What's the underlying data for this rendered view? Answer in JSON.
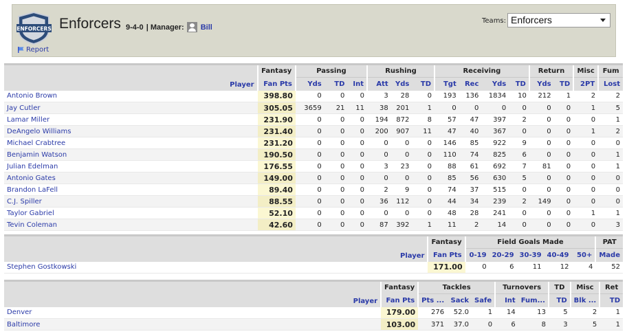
{
  "header": {
    "team_name": "Enforcers",
    "record": "9-4-0",
    "manager_label": "| Manager:",
    "manager_name": "Bill",
    "report_label": "Report",
    "logo_text": "ENFORCERS",
    "teams_label": "Teams:",
    "teams_selected": "Enforcers"
  },
  "offense": {
    "group_headers": [
      "Fantasy",
      "Passing",
      "Rushing",
      "Receiving",
      "Return",
      "Misc",
      "Fum"
    ],
    "player_header": "Player",
    "fan_pts_header": "Fan Pts",
    "sub_headers": [
      "Yds",
      "TD",
      "Int",
      "Att",
      "Yds",
      "TD",
      "Tgt",
      "Rec",
      "Yds",
      "TD",
      "Yds",
      "TD",
      "2PT",
      "Lost"
    ],
    "rows": [
      {
        "name": "Antonio Brown",
        "pts": "398.80",
        "stats": [
          "0",
          "0",
          "0",
          "3",
          "28",
          "0",
          "193",
          "136",
          "1834",
          "10",
          "212",
          "1",
          "2",
          "2"
        ]
      },
      {
        "name": "Jay Cutler",
        "pts": "305.05",
        "stats": [
          "3659",
          "21",
          "11",
          "38",
          "201",
          "1",
          "0",
          "0",
          "0",
          "0",
          "0",
          "0",
          "1",
          "5"
        ]
      },
      {
        "name": "Lamar Miller",
        "pts": "231.90",
        "stats": [
          "0",
          "0",
          "0",
          "194",
          "872",
          "8",
          "57",
          "47",
          "397",
          "2",
          "0",
          "0",
          "0",
          "1"
        ]
      },
      {
        "name": "DeAngelo Williams",
        "pts": "231.40",
        "stats": [
          "0",
          "0",
          "0",
          "200",
          "907",
          "11",
          "47",
          "40",
          "367",
          "0",
          "0",
          "0",
          "1",
          "2"
        ]
      },
      {
        "name": "Michael Crabtree",
        "pts": "231.20",
        "stats": [
          "0",
          "0",
          "0",
          "0",
          "0",
          "0",
          "146",
          "85",
          "922",
          "9",
          "0",
          "0",
          "0",
          "0"
        ]
      },
      {
        "name": "Benjamin Watson",
        "pts": "190.50",
        "stats": [
          "0",
          "0",
          "0",
          "0",
          "0",
          "0",
          "110",
          "74",
          "825",
          "6",
          "0",
          "0",
          "0",
          "1"
        ]
      },
      {
        "name": "Julian Edelman",
        "pts": "176.55",
        "stats": [
          "0",
          "0",
          "0",
          "3",
          "23",
          "0",
          "88",
          "61",
          "692",
          "7",
          "81",
          "0",
          "0",
          "1"
        ]
      },
      {
        "name": "Antonio Gates",
        "pts": "149.00",
        "stats": [
          "0",
          "0",
          "0",
          "0",
          "0",
          "0",
          "85",
          "56",
          "630",
          "5",
          "0",
          "0",
          "0",
          "0"
        ]
      },
      {
        "name": "Brandon LaFell",
        "pts": "89.40",
        "stats": [
          "0",
          "0",
          "0",
          "2",
          "9",
          "0",
          "74",
          "37",
          "515",
          "0",
          "0",
          "0",
          "0",
          "0"
        ]
      },
      {
        "name": "C.J. Spiller",
        "pts": "88.55",
        "stats": [
          "0",
          "0",
          "0",
          "36",
          "112",
          "0",
          "44",
          "34",
          "239",
          "2",
          "149",
          "0",
          "0",
          "0"
        ]
      },
      {
        "name": "Taylor Gabriel",
        "pts": "52.10",
        "stats": [
          "0",
          "0",
          "0",
          "0",
          "0",
          "0",
          "48",
          "28",
          "241",
          "0",
          "0",
          "0",
          "1",
          "1"
        ]
      },
      {
        "name": "Tevin Coleman",
        "pts": "42.60",
        "stats": [
          "0",
          "0",
          "0",
          "87",
          "392",
          "1",
          "11",
          "2",
          "14",
          "0",
          "0",
          "0",
          "0",
          "3"
        ]
      }
    ]
  },
  "kicker": {
    "group_headers": [
      "Fantasy",
      "Field Goals Made",
      "PAT"
    ],
    "player_header": "Player",
    "fan_pts_header": "Fan Pts",
    "sub_headers": [
      "0-19",
      "20-29",
      "30-39",
      "40-49",
      "50+",
      "Made"
    ],
    "rows": [
      {
        "name": "Stephen Gostkowski",
        "pts": "171.00",
        "stats": [
          "0",
          "6",
          "11",
          "12",
          "4",
          "52"
        ]
      }
    ]
  },
  "defense": {
    "group_headers": [
      "Fantasy",
      "Tackles",
      "Turnovers",
      "TD",
      "Misc",
      "Ret"
    ],
    "player_header": "Player",
    "fan_pts_header": "Fan Pts",
    "sub_headers": [
      "Pts ...",
      "Sack",
      "Safe",
      "Int",
      "Fum...",
      "TD",
      "Blk ...",
      "TD"
    ],
    "rows": [
      {
        "name": "Denver",
        "pts": "179.00",
        "stats": [
          "276",
          "52.0",
          "1",
          "14",
          "13",
          "5",
          "2",
          "1"
        ]
      },
      {
        "name": "Baltimore",
        "pts": "103.00",
        "stats": [
          "371",
          "37.0",
          "0",
          "6",
          "8",
          "3",
          "5",
          "1"
        ]
      }
    ]
  }
}
